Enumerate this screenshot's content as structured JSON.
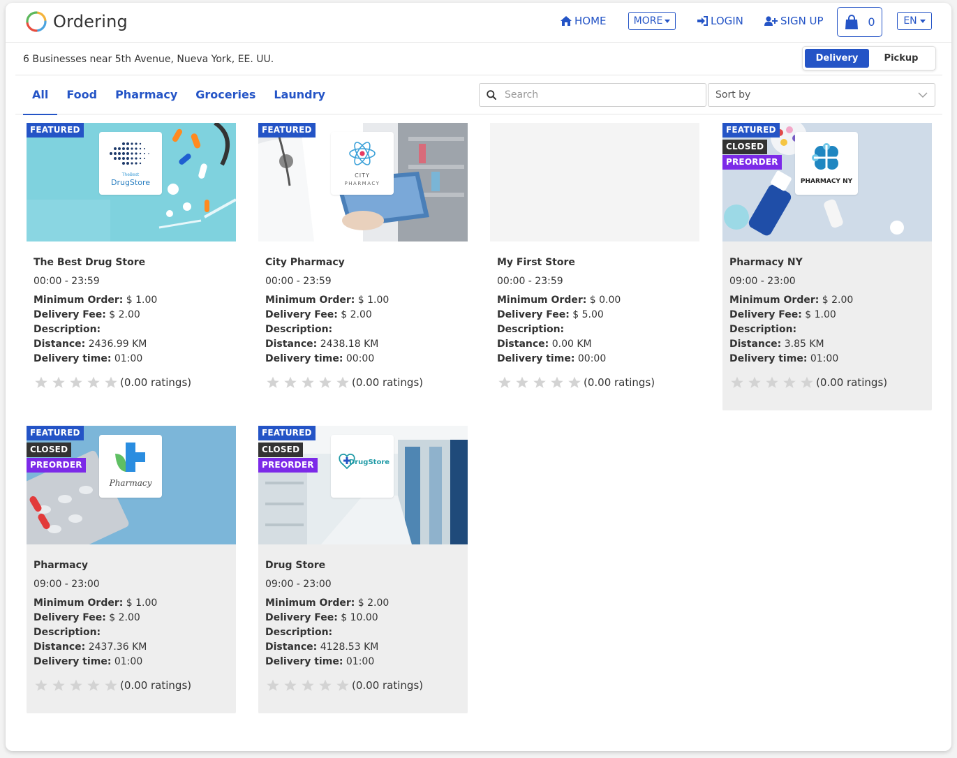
{
  "header": {
    "logo_text": "Ordering",
    "nav": {
      "home": "HOME",
      "more": "MORE",
      "login": "LOGIN",
      "signup": "SIGN UP"
    },
    "cart_count": "0",
    "language": "EN"
  },
  "subheader": {
    "location": "6 Businesses near 5th Avenue, Nueva York, EE. UU.",
    "order_types": [
      "Delivery",
      "Pickup"
    ],
    "active_order_type": "Delivery"
  },
  "filters": {
    "tabs": [
      "All",
      "Food",
      "Pharmacy",
      "Groceries",
      "Laundry"
    ],
    "active_tab": "All",
    "search_placeholder": "Search",
    "sort_label": "Sort by"
  },
  "labels": {
    "featured": "FEATURED",
    "closed": "CLOSED",
    "preorder": "PREORDER",
    "min_order": "Minimum Order:",
    "delivery_fee": "Delivery Fee:",
    "description": "Description:",
    "distance": "Distance:",
    "delivery_time": "Delivery time:"
  },
  "businesses": [
    {
      "name": "The Best Drug Store",
      "hours": "00:00 - 23:59",
      "min_order": "$ 1.00",
      "delivery_fee": "$ 2.00",
      "description": "",
      "distance": "2436.99 KM",
      "delivery_time": "01:00",
      "ratings": "(0.00 ratings)",
      "featured": true,
      "closed": false,
      "preorder": false,
      "logo_text": "TheBest DrugStore"
    },
    {
      "name": "City Pharmacy",
      "hours": "00:00 - 23:59",
      "min_order": "$ 1.00",
      "delivery_fee": "$ 2.00",
      "description": "",
      "distance": "2438.18 KM",
      "delivery_time": "00:00",
      "ratings": "(0.00 ratings)",
      "featured": true,
      "closed": false,
      "preorder": false,
      "logo_text": "CITY PHARMACY"
    },
    {
      "name": "My First Store",
      "hours": "00:00 - 23:59",
      "min_order": "$ 0.00",
      "delivery_fee": "$ 5.00",
      "description": "",
      "distance": "0.00 KM",
      "delivery_time": "00:00",
      "ratings": "(0.00 ratings)",
      "featured": false,
      "closed": false,
      "preorder": false,
      "logo_text": ""
    },
    {
      "name": "Pharmacy NY",
      "hours": "09:00 - 23:00",
      "min_order": "$ 2.00",
      "delivery_fee": "$ 1.00",
      "description": "",
      "distance": "3.85 KM",
      "delivery_time": "01:00",
      "ratings": "(0.00 ratings)",
      "featured": true,
      "closed": true,
      "preorder": true,
      "logo_text": "PHARMACY NY"
    },
    {
      "name": "Pharmacy",
      "hours": "09:00 - 23:00",
      "min_order": "$ 1.00",
      "delivery_fee": "$ 2.00",
      "description": "",
      "distance": "2437.36 KM",
      "delivery_time": "01:00",
      "ratings": "(0.00 ratings)",
      "featured": true,
      "closed": true,
      "preorder": true,
      "logo_text": "Pharmacy"
    },
    {
      "name": "Drug Store",
      "hours": "09:00 - 23:00",
      "min_order": "$ 2.00",
      "delivery_fee": "$ 10.00",
      "description": "",
      "distance": "4128.53 KM",
      "delivery_time": "01:00",
      "ratings": "(0.00 ratings)",
      "featured": true,
      "closed": true,
      "preorder": true,
      "logo_text": "DrugStore"
    }
  ],
  "colors": {
    "accent": "#2454c6",
    "preorder": "#7c2ae8",
    "closed": "#333333"
  }
}
